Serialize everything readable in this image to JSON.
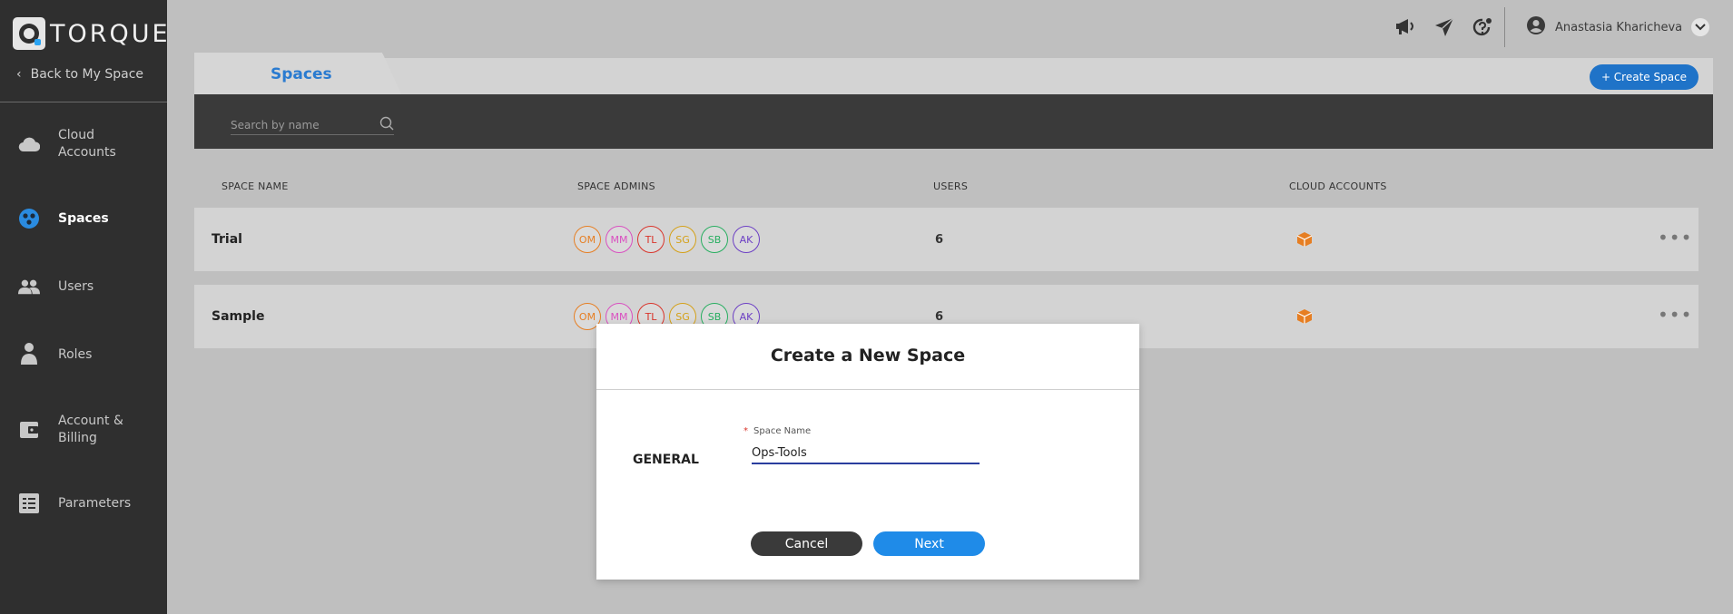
{
  "sidebar": {
    "logo_text": "TORQUE",
    "back_label": "Back to My Space",
    "items": [
      {
        "label": "Cloud\nAccounts",
        "icon": "cloud-icon"
      },
      {
        "label": "Spaces",
        "icon": "spaces-icon"
      },
      {
        "label": "Users",
        "icon": "users-icon"
      },
      {
        "label": "Roles",
        "icon": "roles-icon"
      },
      {
        "label": "Account &\nBilling",
        "icon": "billing-icon"
      },
      {
        "label": "Parameters",
        "icon": "parameters-icon"
      }
    ]
  },
  "header": {
    "user_name": "Anastasia Kharicheva",
    "icons": [
      "megaphone-icon",
      "paper-plane-icon",
      "help-refresh-icon"
    ]
  },
  "tabs": {
    "active_label": "Spaces",
    "create_label": "+ Create Space"
  },
  "search": {
    "placeholder": "Search by name"
  },
  "table": {
    "headers": [
      "SPACE NAME",
      "SPACE ADMINS",
      "USERS",
      "CLOUD ACCOUNTS"
    ],
    "rows": [
      {
        "name": "Trial",
        "admins": [
          "OM",
          "MM",
          "TL",
          "SG",
          "SB",
          "AK"
        ],
        "users": "6"
      },
      {
        "name": "Sample",
        "admins": [
          "OM",
          "MM",
          "TL",
          "SG",
          "SB",
          "AK"
        ],
        "users": "6"
      }
    ],
    "row_menu": "•••"
  },
  "modal": {
    "title": "Create a New Space",
    "section": "GENERAL",
    "field_label": "Space Name",
    "required_mark": "*",
    "field_value": "Ops-Tools",
    "cancel_label": "Cancel",
    "next_label": "Next"
  },
  "colors": {
    "accent": "#2a7bd0",
    "avatar_colors": [
      "#e67e22",
      "#d94fc0",
      "#d9342b",
      "#d4a017",
      "#27ae60",
      "#6c3fc4"
    ],
    "cloud_account": "#e67e22"
  }
}
